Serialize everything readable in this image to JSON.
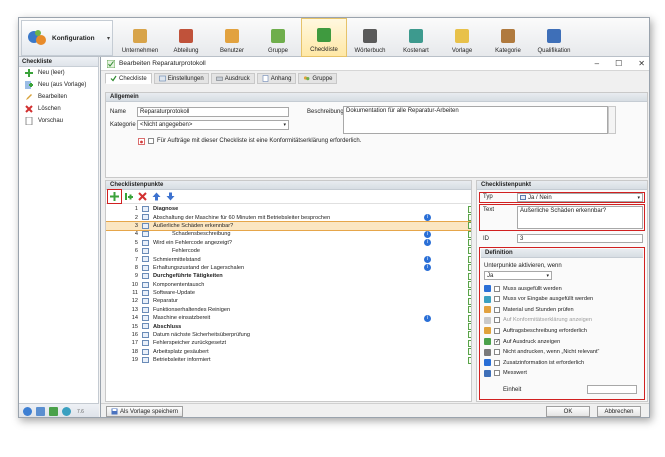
{
  "ribbon": {
    "konfiguration_label": "Konfiguration",
    "items": [
      {
        "label": "Unternehmen",
        "icon": "building-icon"
      },
      {
        "label": "Abteilung",
        "icon": "department-icon"
      },
      {
        "label": "Benutzer",
        "icon": "user-icon"
      },
      {
        "label": "Gruppe",
        "icon": "group-icon"
      },
      {
        "label": "Checkliste",
        "icon": "checklist-icon",
        "active": true
      },
      {
        "label": "Wörterbuch",
        "icon": "dictionary-icon"
      },
      {
        "label": "Kostenart",
        "icon": "cost-icon"
      },
      {
        "label": "Vorlage",
        "icon": "template-icon"
      },
      {
        "label": "Kategorie",
        "icon": "category-icon"
      },
      {
        "label": "Qualifikation",
        "icon": "qualification-icon"
      }
    ]
  },
  "left": {
    "header": "Checkliste",
    "items": [
      "Neu (leer)",
      "Neu (aus Vorlage)",
      "Bearbeiten",
      "Löschen",
      "Vorschau"
    ],
    "footer_text": "7.6"
  },
  "dialog": {
    "title": "Bearbeiten Reparaturprotokoll",
    "tabs": [
      "Checkliste",
      "Einstellungen",
      "Ausdruck",
      "Anhang",
      "Gruppe"
    ],
    "allgemein": {
      "header": "Allgemein",
      "name_label": "Name",
      "name_value": "Reparaturprotokoll",
      "kategorie_label": "Kategorie",
      "kategorie_value": "<Nicht angegeben>",
      "beschreibung_label": "Beschreibung",
      "beschreibung_value": "Dokumentation für alle Reparatur-Arbeiten",
      "konform_text": "Für Aufträge mit dieser Checkliste ist eine Konformitätserklärung erforderlich."
    },
    "checklistenpunkte": {
      "header": "Checklistenpunkte",
      "rows": [
        {
          "n": "1",
          "label": "Diagnose",
          "bold": true
        },
        {
          "n": "2",
          "label": "Abschaltung der Maschine für 60 Minuten mit Betriebsleiter besprochen",
          "info": true
        },
        {
          "n": "3",
          "label": "Äußerliche Schäden erkennbar?",
          "selected": true
        },
        {
          "n": "4",
          "label": "Schadensbeschreibung",
          "indent": true,
          "info": true
        },
        {
          "n": "5",
          "label": "Wird ein Fehlercode angezeigt?",
          "info": true
        },
        {
          "n": "6",
          "label": "Fehlercode",
          "indent": true
        },
        {
          "n": "7",
          "label": "Schmiermittelstand",
          "info": true
        },
        {
          "n": "8",
          "label": "Erhaltungszustand der Lagerschalen",
          "info": true,
          "grid": true
        },
        {
          "n": "9",
          "label": "Durchgeführte Tätigkeiten",
          "bold": true
        },
        {
          "n": "10",
          "label": "Komponententausch",
          "red": true
        },
        {
          "n": "11",
          "label": "Software-Update",
          "red": true
        },
        {
          "n": "12",
          "label": "Reparatur",
          "red": true
        },
        {
          "n": "13",
          "label": "Funktionserhaltendes Reinigen",
          "red": true
        },
        {
          "n": "14",
          "label": "Maschine einsatzbereit",
          "info": true,
          "grid": true
        },
        {
          "n": "15",
          "label": "Abschluss",
          "bold": true
        },
        {
          "n": "16",
          "label": "Datum nächste Sicherheitsüberprüfung"
        },
        {
          "n": "17",
          "label": "Fehlerspeicher zurückgesetzt"
        },
        {
          "n": "18",
          "label": "Arbeitsplatz gesäubert"
        },
        {
          "n": "19",
          "label": "Betriebsleiter informiert"
        }
      ]
    },
    "checklistenpunkt": {
      "header": "Checklistenpunkt",
      "typ_label": "Typ",
      "typ_value": "Ja / Nein",
      "text_label": "Text",
      "text_value": "Äußerliche Schäden erkennbar?",
      "id_label": "ID",
      "id_value": "3",
      "definition_header": "Definition",
      "unterpunkte_label": "Unterpunkte aktivieren, wenn",
      "unterpunkte_value": "Ja",
      "options": [
        {
          "label": "Muss ausgefüllt werden",
          "checked": false
        },
        {
          "label": "Muss vor Eingabe ausgefüllt werden",
          "checked": false
        },
        {
          "label": "Material und Stunden prüfen",
          "checked": false
        },
        {
          "label": "Auf Konformitätserklärung anzeigen",
          "checked": false,
          "disabled": true
        },
        {
          "label": "Auftragsbeschreibung erforderlich",
          "checked": false
        },
        {
          "label": "Auf Ausdruck anzeigen",
          "checked": true
        },
        {
          "label": "Nicht andrucken, wenn „Nicht relevant“",
          "checked": false
        },
        {
          "label": "Zusatzinformation ist erforderlich",
          "checked": false
        },
        {
          "label": "Messwert",
          "checked": false
        }
      ],
      "einheit_label": "Einheit"
    },
    "buttons": {
      "save_template": "Als Vorlage speichern",
      "ok": "OK",
      "cancel": "Abbrechen"
    }
  }
}
